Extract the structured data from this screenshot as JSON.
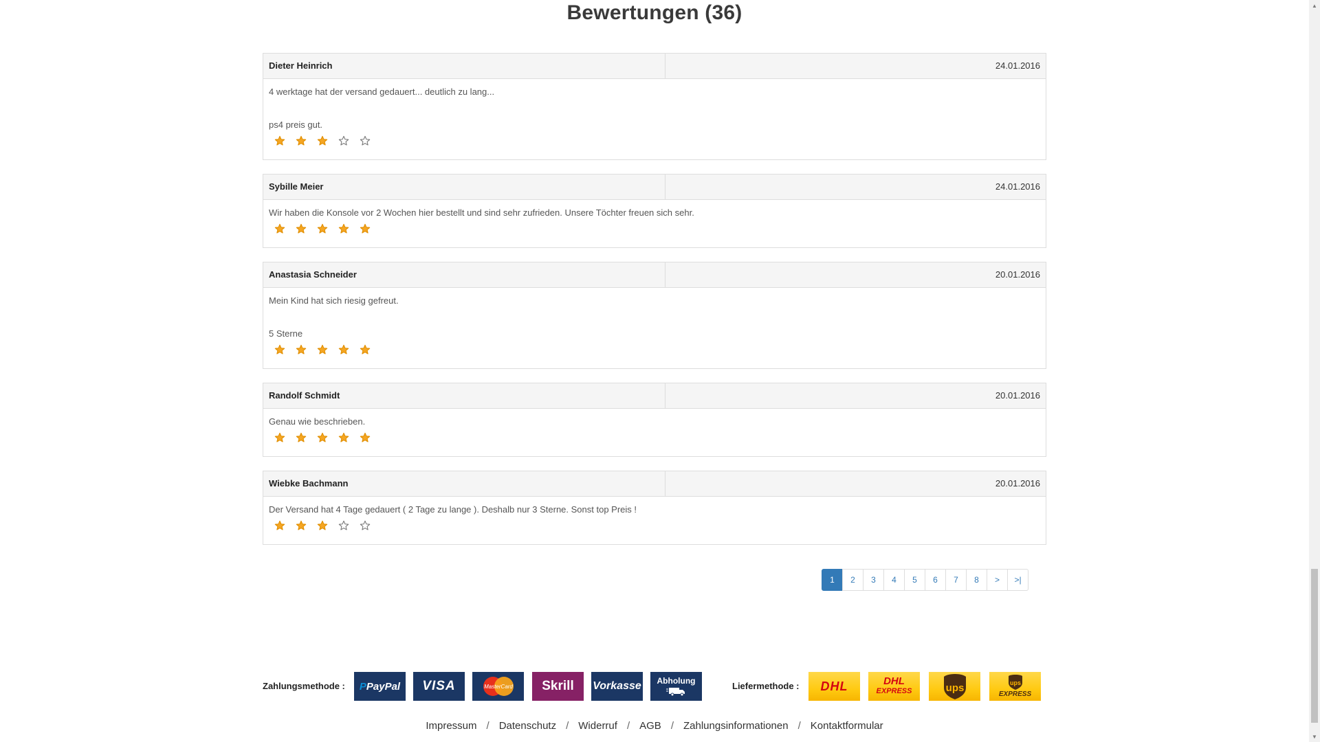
{
  "section": {
    "title": "Bewertungen (36)"
  },
  "reviews": [
    {
      "author": "Dieter Heinrich",
      "date": "24.01.2016",
      "text": "4 werktage hat der versand gedauert... deutlich zu lang...",
      "extra": "ps4 preis gut.",
      "rating": 3
    },
    {
      "author": "Sybille Meier",
      "date": "24.01.2016",
      "text": "Wir haben die Konsole vor 2 Wochen hier bestellt und sind sehr zufrieden. Unsere Töchter freuen sich sehr.",
      "extra": "",
      "rating": 5
    },
    {
      "author": "Anastasia Schneider",
      "date": "20.01.2016",
      "text": "Mein Kind hat sich riesig gefreut.",
      "extra": "5 Sterne",
      "rating": 5
    },
    {
      "author": "Randolf Schmidt",
      "date": "20.01.2016",
      "text": "Genau wie beschrieben.",
      "extra": "",
      "rating": 5
    },
    {
      "author": "Wiebke Bachmann",
      "date": "20.01.2016",
      "text": "Der Versand hat 4 Tage gedauert ( 2 Tage zu lange ). Deshalb nur 3 Sterne. Sonst top Preis !",
      "extra": "",
      "rating": 3
    }
  ],
  "rating_max": 5,
  "colors": {
    "star_filled": "#f5a623",
    "star_empty": "#777777",
    "accent": "#337ab7"
  },
  "pagination": {
    "pages": [
      "1",
      "2",
      "3",
      "4",
      "5",
      "6",
      "7",
      "8"
    ],
    "current": "1",
    "next": ">",
    "last": ">|"
  },
  "payment": {
    "label": "Zahlungsmethode :",
    "methods": [
      {
        "name": "PayPal",
        "icon": "paypal-logo"
      },
      {
        "name": "VISA",
        "icon": "visa-logo"
      },
      {
        "name": "MasterCard",
        "icon": "mastercard-logo"
      },
      {
        "name": "Skrill",
        "icon": "skrill-logo"
      },
      {
        "name": "Vorkasse",
        "icon": "vorkasse-logo"
      },
      {
        "name": "Abholung",
        "icon": "abholung-truck-logo"
      }
    ]
  },
  "shipping": {
    "label": "Liefermethode :",
    "methods": [
      {
        "name": "DHL",
        "icon": "dhl-logo"
      },
      {
        "name": "DHL",
        "sub": "EXPRESS",
        "icon": "dhl-express-logo"
      },
      {
        "name": "ups",
        "icon": "ups-logo"
      },
      {
        "name": "ups",
        "sub": "EXPRESS",
        "icon": "ups-express-logo"
      }
    ]
  },
  "footer_links": [
    "Impressum",
    "Datenschutz",
    "Widerruf",
    "AGB",
    "Zahlungsinformationen",
    "Kontaktformular"
  ]
}
